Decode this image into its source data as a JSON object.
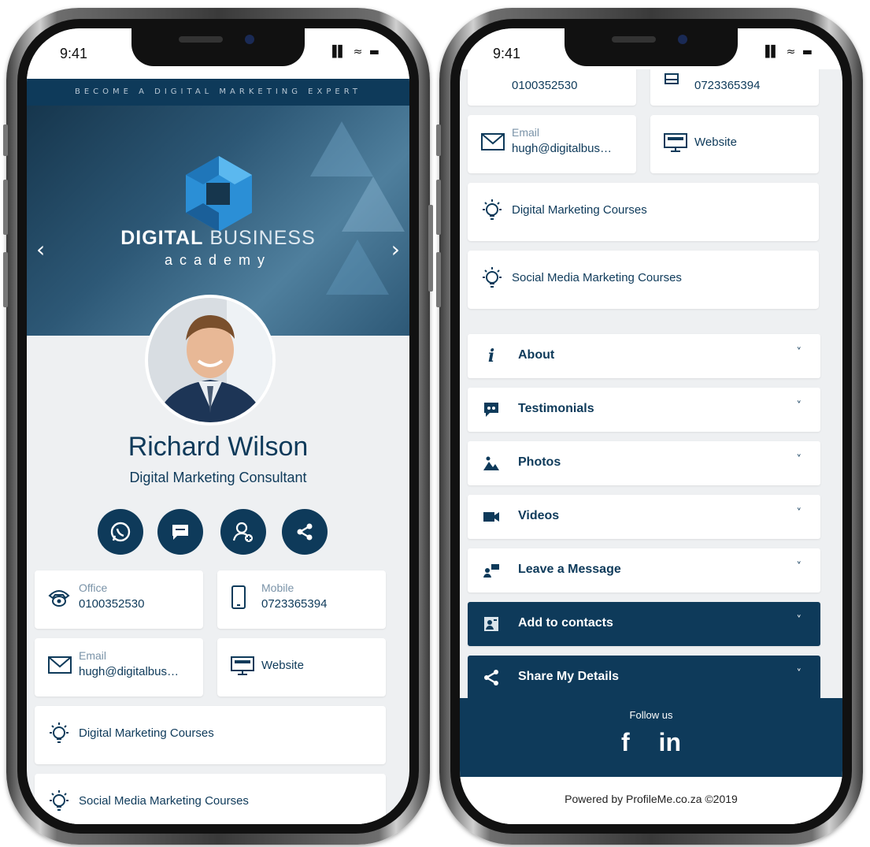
{
  "status": {
    "time": "9:41",
    "icons": "▐▌ ≈ ▬"
  },
  "left": {
    "banner": "BECOME A DIGITAL MARKETING EXPERT",
    "logo": {
      "bold": "DIGITAL",
      "light": " BUSINESS",
      "sub": "academy"
    },
    "profile": {
      "name": "Richard Wilson",
      "role": "Digital Marketing Consultant"
    },
    "actions": [
      "whatsapp-icon",
      "message-icon",
      "add-contact-icon",
      "share-icon"
    ],
    "contacts": {
      "office": {
        "label": "Office",
        "value": "0100352530"
      },
      "mobile": {
        "label": "Mobile",
        "value": "0723365394"
      },
      "email": {
        "label": "Email",
        "value": "hugh@digitalbus…"
      },
      "website": {
        "label": "Website"
      }
    },
    "links": [
      "Digital Marketing Courses",
      "Social Media Marketing Courses"
    ]
  },
  "right": {
    "contacts": {
      "office": {
        "value": "0100352530"
      },
      "mobile": {
        "value": "0723365394"
      },
      "email": {
        "label": "Email",
        "value": "hugh@digitalbus…"
      },
      "website": {
        "label": "Website"
      }
    },
    "links": [
      "Digital Marketing Courses",
      "Social Media Marketing Courses"
    ],
    "accordion": [
      {
        "label": "About",
        "icon": "info-icon"
      },
      {
        "label": "Testimonials",
        "icon": "testimonial-icon"
      },
      {
        "label": "Photos",
        "icon": "photos-icon"
      },
      {
        "label": "Videos",
        "icon": "video-icon"
      },
      {
        "label": "Leave a Message",
        "icon": "message-icon"
      },
      {
        "label": "Add to contacts",
        "icon": "contact-card-icon"
      },
      {
        "label": "Share My Details",
        "icon": "share-icon"
      }
    ],
    "chevron": "˅",
    "follow": {
      "label": "Follow us",
      "facebook": "f",
      "linkedin": "in"
    },
    "footer": "Powered by ProfileMe.co.za ©2019"
  },
  "colors": {
    "brand": "#0e3a5a",
    "background": "#eef0f2",
    "label": "#7a93a8"
  }
}
